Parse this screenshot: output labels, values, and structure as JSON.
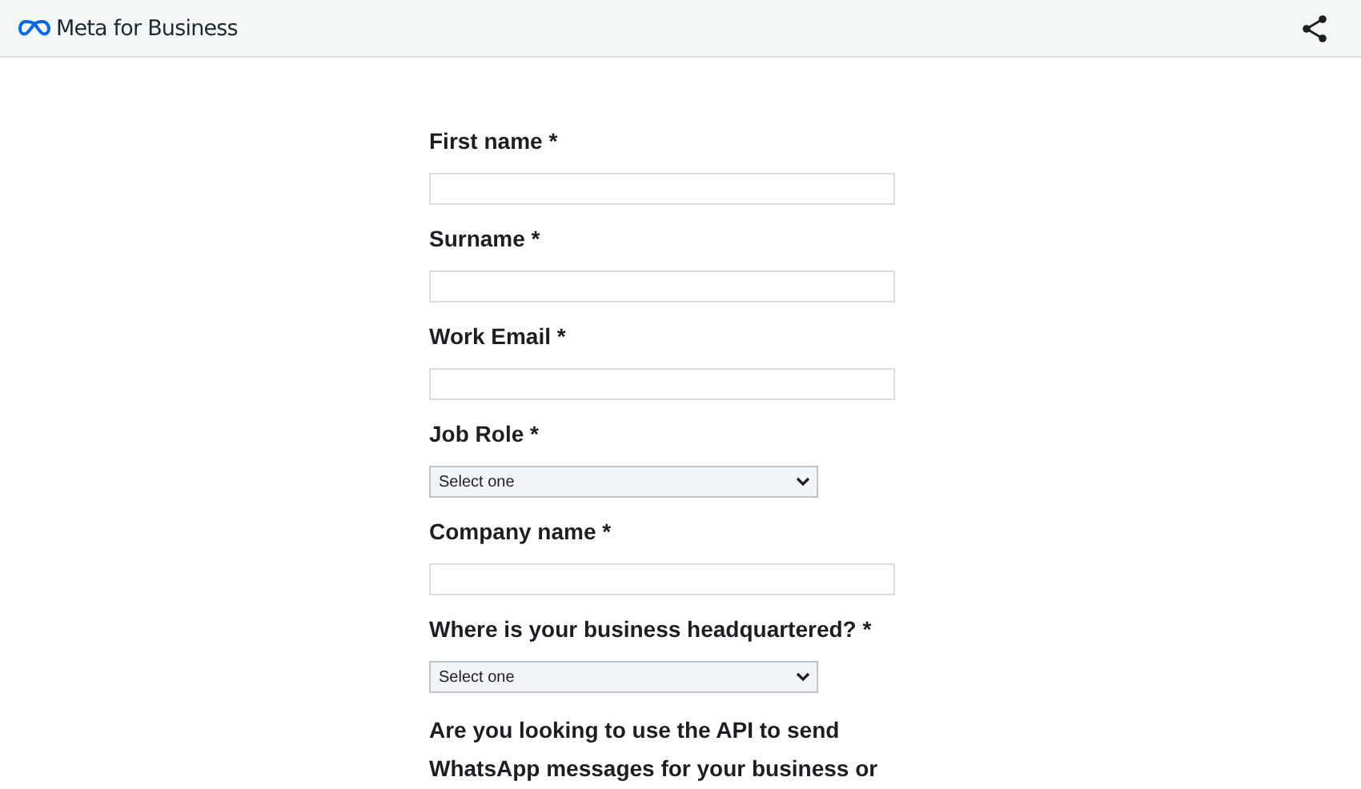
{
  "header": {
    "brand": "Meta for Business"
  },
  "form": {
    "fields": [
      {
        "kind": "text",
        "label": "First name *"
      },
      {
        "kind": "text",
        "label": "Surname *"
      },
      {
        "kind": "text",
        "label": "Work Email *"
      },
      {
        "kind": "select",
        "label": "Job Role *",
        "placeholder": "Select one"
      },
      {
        "kind": "text",
        "label": "Company name *"
      },
      {
        "kind": "select",
        "label": "Where is your business headquartered? *",
        "placeholder": "Select one"
      }
    ],
    "question": "Are you looking to use the API to send WhatsApp messages for your business or"
  }
}
